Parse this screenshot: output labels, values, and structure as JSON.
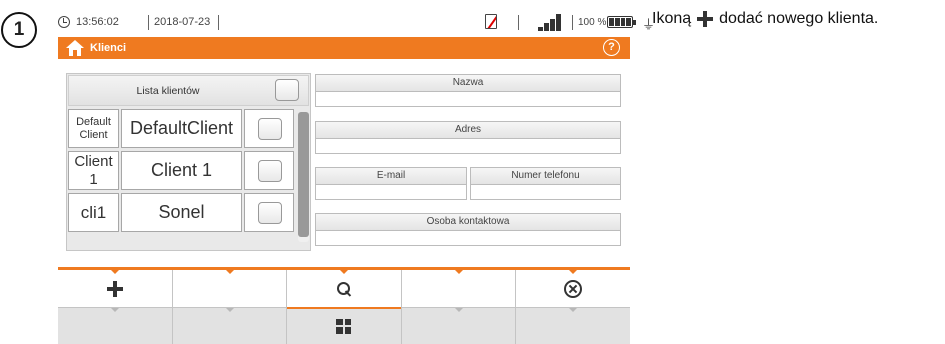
{
  "step_number": "1",
  "instruction": {
    "before": "Ikoną",
    "after": "dodać nowego klienta.",
    "icon": "plus-icon"
  },
  "status_bar": {
    "time": "13:56:02",
    "date": "2018-07-23",
    "battery_percent": "100 %",
    "icons": [
      "clock-icon",
      "no-sim-icon",
      "signal-icon",
      "battery-icon",
      "plug-icon"
    ]
  },
  "title_bar": {
    "title": "Klienci",
    "help_label": "?",
    "accent_color": "#ef7a20"
  },
  "client_list": {
    "header_label": "Lista klientów",
    "rows": [
      {
        "id": "Default Client",
        "name": "DefaultClient"
      },
      {
        "id": "Client 1",
        "name": "Client 1"
      },
      {
        "id": "cli1",
        "name": "Sonel"
      }
    ]
  },
  "details": {
    "name_label": "Nazwa",
    "address_label": "Adres",
    "email_label": "E-mail",
    "phone_label": "Numer telefonu",
    "contact_label": "Osoba kontaktowa"
  },
  "toolbar": {
    "row1": [
      "plus-icon",
      "",
      "search-icon",
      "",
      "close-circle-icon"
    ],
    "row2": [
      "",
      "",
      "grid-icon",
      "",
      ""
    ]
  }
}
